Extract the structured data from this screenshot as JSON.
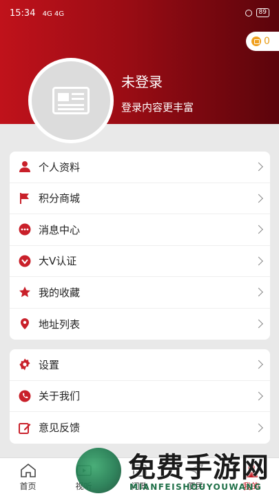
{
  "status_bar": {
    "time": "15:34",
    "signal_text": "4G 4G",
    "battery": "89"
  },
  "header": {
    "points_value": "0",
    "user_name": "未登录",
    "user_sub": "登录内容更丰富"
  },
  "menu_group_1": [
    {
      "label": "个人资料",
      "icon": "person-icon"
    },
    {
      "label": "积分商城",
      "icon": "flag-icon"
    },
    {
      "label": "消息中心",
      "icon": "message-icon"
    },
    {
      "label": "大V认证",
      "icon": "verify-icon"
    },
    {
      "label": "我的收藏",
      "icon": "star-icon"
    },
    {
      "label": "地址列表",
      "icon": "location-icon"
    }
  ],
  "menu_group_2": [
    {
      "label": "设置",
      "icon": "settings-icon"
    },
    {
      "label": "关于我们",
      "icon": "phone-icon"
    },
    {
      "label": "意见反馈",
      "icon": "edit-icon"
    }
  ],
  "tabs": [
    {
      "label": "首页",
      "icon": "home-icon"
    },
    {
      "label": "视听",
      "icon": "video-icon"
    },
    {
      "label": "问政",
      "icon": "inquiry-icon"
    },
    {
      "label": "便民",
      "icon": "send-icon"
    },
    {
      "label": "我的",
      "icon": "profile-icon"
    }
  ],
  "colors": {
    "accent": "#c0121b",
    "header_dark": "#5b040b"
  },
  "watermark": {
    "title": "免费手游网",
    "subtitle": "MIANFEISHOUYOUWANG"
  }
}
